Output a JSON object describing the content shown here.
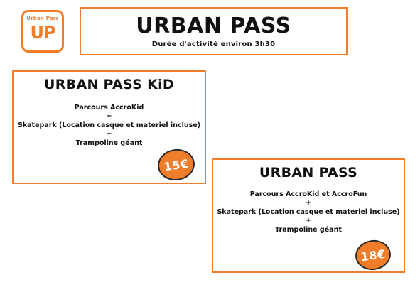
{
  "logo": {
    "top_text": "Urban Parc",
    "mark_text": "UP"
  },
  "header": {
    "title": "URBAN PASS",
    "subtitle": "Durée d'activité environ 3h30"
  },
  "cards": [
    {
      "title": "URBAN PASS KiD",
      "lines": [
        "Parcours AccroKid",
        "+",
        "Skatepark (Location casque et materiel incluse)",
        "+",
        "Trampoline géant"
      ],
      "price": "15€"
    },
    {
      "title": "URBAN PASS",
      "lines": [
        "Parcours AccroKid et AccroFun",
        "+",
        "Skatepark (Location casque et materiel incluse)",
        "+",
        "Trampoline géant"
      ],
      "price": "18€"
    }
  ],
  "colors": {
    "accent": "#ef7d2a",
    "text": "#111111",
    "badge_outline": "#2a2a2a",
    "background": "#ffffff"
  }
}
